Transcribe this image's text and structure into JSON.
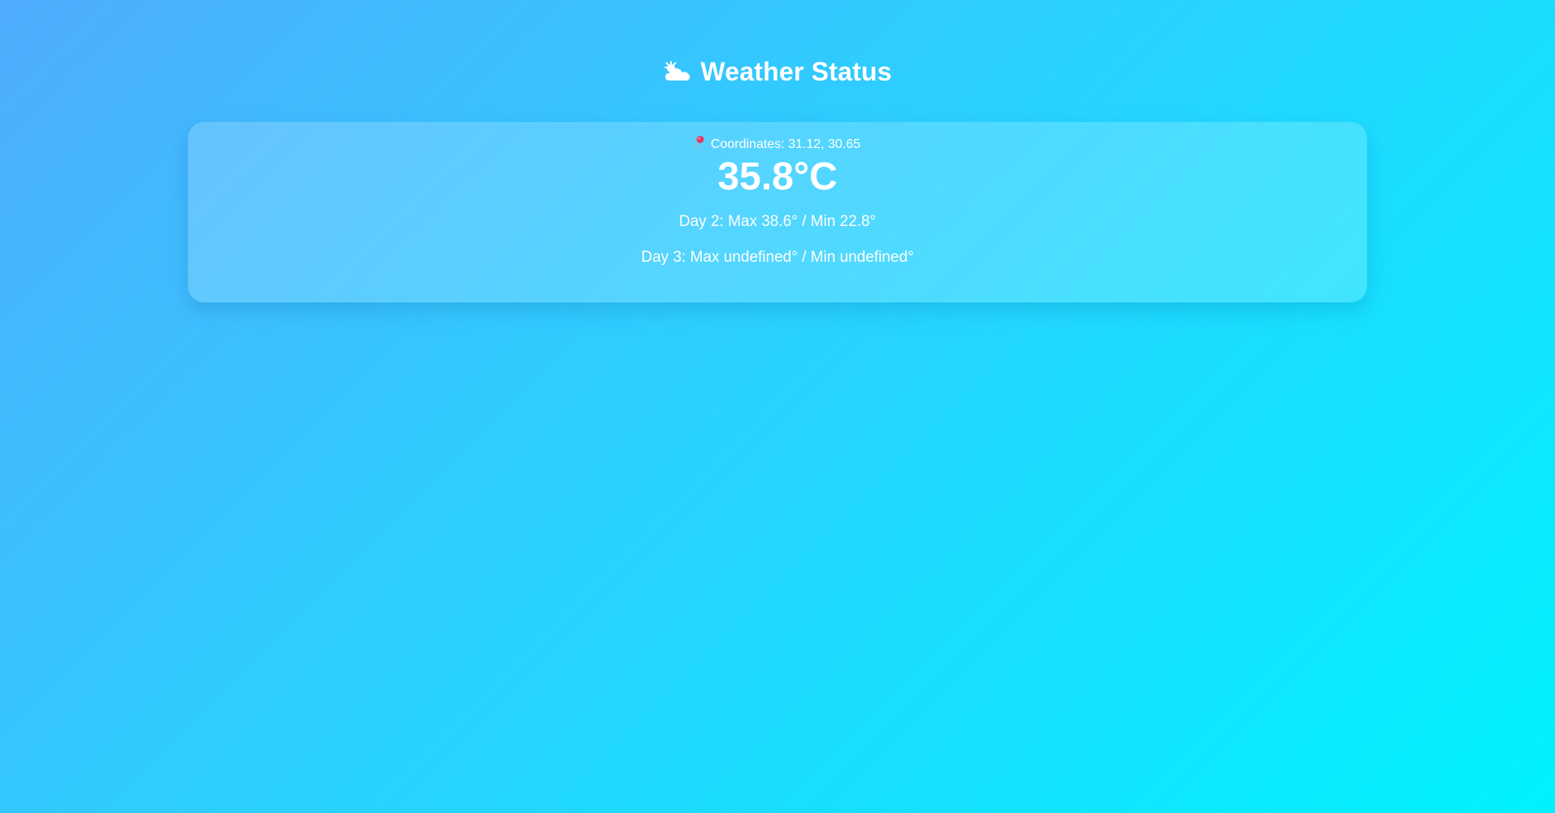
{
  "header": {
    "icon": "sun-behind-cloud-icon",
    "title": "Weather Status"
  },
  "weather": {
    "coordinates_icon": "round-pushpin-icon",
    "coordinates_text": "Coordinates: 31.12, 30.65",
    "current_temperature": "35.8°C",
    "forecast": [
      {
        "text": "Day 2: Max 38.6° / Min 22.8°"
      },
      {
        "text": "Day 3: Max undefined° / Min undefined°"
      }
    ]
  },
  "colors": {
    "gradient_start": "#4facfe",
    "gradient_end": "#00f2fe",
    "text": "#ffffff",
    "pin": "#e8365d"
  }
}
